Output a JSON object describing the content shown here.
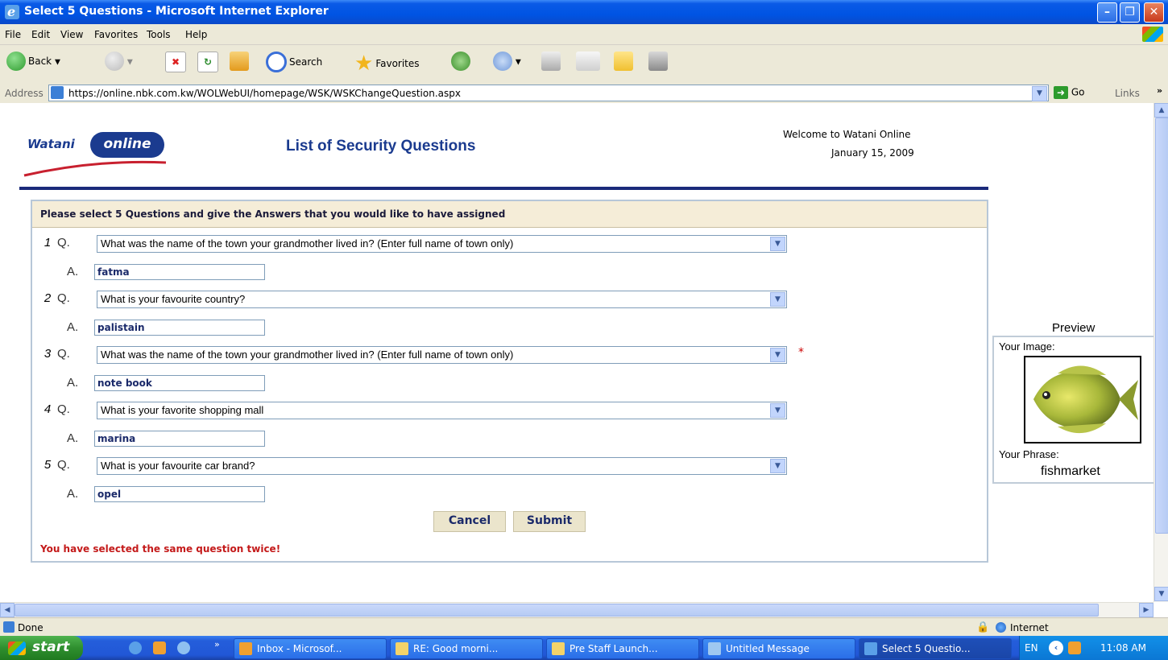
{
  "window": {
    "title": "Select 5 Questions - Microsoft Internet Explorer"
  },
  "menu": [
    "File",
    "Edit",
    "View",
    "Favorites",
    "Tools",
    "Help"
  ],
  "toolbar": {
    "back": "Back",
    "search": "Search",
    "favorites": "Favorites"
  },
  "address": {
    "label": "Address",
    "url": "https://online.nbk.com.kw/WOLWebUI/homepage/WSK/WSKChangeQuestion.aspx",
    "go": "Go",
    "links": "Links"
  },
  "page": {
    "logo_watani": "Watani",
    "logo_online": "online",
    "title": "List of Security Questions",
    "welcome": "Welcome to Watani Online",
    "date": "January 15, 2009",
    "instructions": "Please select 5 Questions and give the Answers that you would like to have assigned",
    "q_label": "Q.",
    "a_label": "A.",
    "questions": [
      {
        "num": "1",
        "question": "What was the name of the town your grandmother lived in? (Enter full name of town only)",
        "answer": "fatma"
      },
      {
        "num": "2",
        "question": "What is your favourite country?",
        "answer": "palistain"
      },
      {
        "num": "3",
        "question": "What was the name of the town your grandmother lived in? (Enter full name of town only)",
        "answer": "note book"
      },
      {
        "num": "4",
        "question": "What is your favorite shopping mall",
        "answer": "marina"
      },
      {
        "num": "5",
        "question": "What is your favourite car brand?",
        "answer": "opel"
      }
    ],
    "required_mark": "*",
    "cancel": "Cancel",
    "submit": "Submit",
    "error": "You have selected the same question twice!",
    "preview": {
      "title": "Preview",
      "image_label": "Your Image:",
      "phrase_label": "Your Phrase:",
      "phrase": "fishmarket"
    }
  },
  "status": {
    "text": "Done",
    "zone": "Internet"
  },
  "taskbar": {
    "start": "start",
    "tasks": [
      "Inbox - Microsof...",
      "RE: Good morni...",
      "Pre Staff Launch...",
      "Untitled Message",
      "Select 5 Questio..."
    ],
    "lang": "EN",
    "time": "11:08 AM"
  }
}
